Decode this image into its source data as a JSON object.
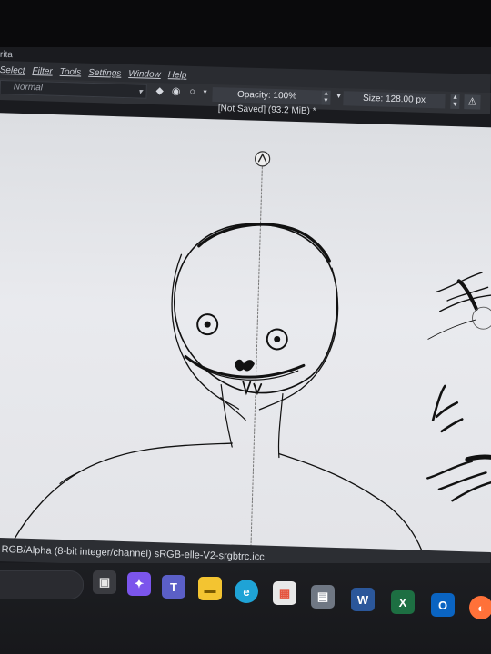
{
  "app": {
    "title": "rita"
  },
  "menu": {
    "items": [
      "Select",
      "Filter",
      "Tools",
      "Settings",
      "Window",
      "Help"
    ]
  },
  "toolbar": {
    "blend_mode": "Normal",
    "opacity_label": "Opacity: 100%",
    "size_label": "Size: 128.00 px"
  },
  "document": {
    "tab_title": "[Not Saved]  (93.2 MiB) *"
  },
  "status": {
    "text": "RGB/Alpha (8-bit integer/channel)  sRGB-elle-V2-srgbtrc.icc"
  },
  "taskbar": {
    "apps": [
      {
        "name": "Task View",
        "icon": "task-view-icon",
        "color": "#e7e7e7"
      },
      {
        "name": "Copilot",
        "icon": "copilot-icon",
        "color": "#8a5cf6"
      },
      {
        "name": "Teams",
        "icon": "teams-icon",
        "color": "#5b5fc7"
      },
      {
        "name": "File Explorer",
        "icon": "folder-icon",
        "color": "#f3c431"
      },
      {
        "name": "Edge",
        "icon": "edge-icon",
        "color": "#1fa3d6"
      },
      {
        "name": "Microsoft Store",
        "icon": "store-icon",
        "color": "#e8e8e8"
      },
      {
        "name": "Calculator",
        "icon": "calculator-icon",
        "color": "#6f7783"
      },
      {
        "name": "Word",
        "icon": "word-icon",
        "color": "#2b579a"
      },
      {
        "name": "Excel",
        "icon": "excel-icon",
        "color": "#1d6f42"
      },
      {
        "name": "Outlook",
        "icon": "outlook-icon",
        "color": "#0a64c2"
      },
      {
        "name": "Firefox",
        "icon": "firefox-icon",
        "color": "#ff7139"
      }
    ]
  },
  "colors": {
    "canvas": "#e6e7eb",
    "chrome": "#2a2c31",
    "ink": "#111111"
  }
}
